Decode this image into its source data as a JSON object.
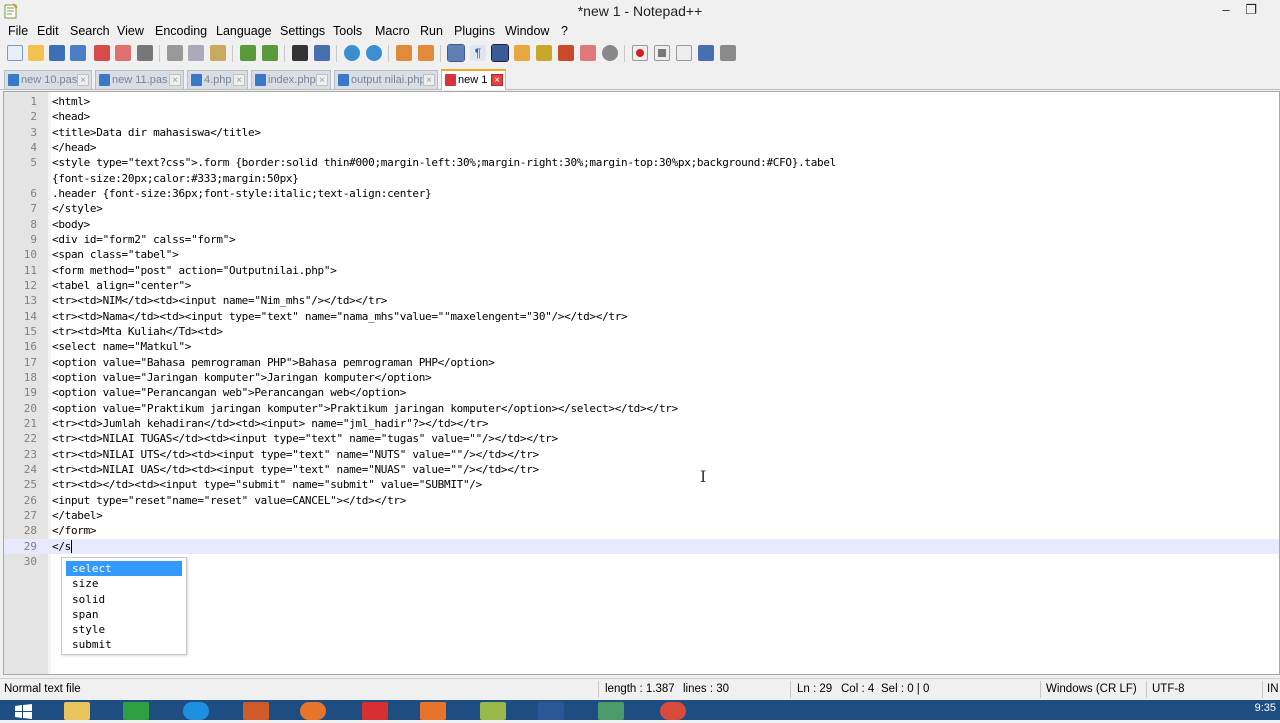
{
  "window": {
    "title": "*new 1 - Notepad++"
  },
  "menu": [
    "File",
    "Edit",
    "Search",
    "View",
    "Encoding",
    "Language",
    "Settings",
    "Tools",
    "Macro",
    "Run",
    "Plugins",
    "Window",
    "?"
  ],
  "tabs": [
    {
      "label": "new 10.pas",
      "active": false
    },
    {
      "label": "new 11.pas",
      "active": false
    },
    {
      "label": "4.php",
      "active": false
    },
    {
      "label": "index.php",
      "active": false
    },
    {
      "label": "output nilai.php",
      "active": false
    },
    {
      "label": "new 1",
      "active": true
    }
  ],
  "editor": {
    "current_line": 29,
    "lines": [
      {
        "n": "1",
        "text": "<html>"
      },
      {
        "n": "2",
        "text": "<head>"
      },
      {
        "n": "3",
        "text": "<title>Data dir mahasiswa</title>"
      },
      {
        "n": "4",
        "text": "</head>"
      },
      {
        "n": "5",
        "text": "<style type=\"text?css\">.form {border:solid thin#000;margin-left:30%;margin-right:30%;margin-top:30%px;background:#CFO}.tabel"
      },
      {
        "n": "",
        "text": "{font-size:20px;calor:#333;margin:50px}"
      },
      {
        "n": "6",
        "text": ".header {font-size:36px;font-style:italic;text-align:center}"
      },
      {
        "n": "7",
        "text": "</style>"
      },
      {
        "n": "8",
        "text": "<body>"
      },
      {
        "n": "9",
        "text": "<div id=\"form2\" calss=\"form\">"
      },
      {
        "n": "10",
        "text": "<span class=\"tabel\">"
      },
      {
        "n": "11",
        "text": "<form method=\"post\" action=\"Outputnilai.php\">"
      },
      {
        "n": "12",
        "text": "<tabel align=\"center\">"
      },
      {
        "n": "13",
        "text": "<tr><td>NIM</td><td><input name=\"Nim_mhs\"/></td></tr>"
      },
      {
        "n": "14",
        "text": "<tr><td>Nama</td><td><input type=\"text\" name=\"nama_mhs\"value=\"\"maxelengent=\"30\"/></td></tr>"
      },
      {
        "n": "15",
        "text": "<tr><td>Mta Kuliah</Td><td>"
      },
      {
        "n": "16",
        "text": "<select name=\"Matkul\">"
      },
      {
        "n": "17",
        "text": "<option value=\"Bahasa pemrograman PHP\">Bahasa pemrograman PHP</option>"
      },
      {
        "n": "18",
        "text": "<option value=\"Jaringan komputer\">Jaringan komputer</option>"
      },
      {
        "n": "19",
        "text": "<option value=\"Perancangan web\">Perancangan web</option>"
      },
      {
        "n": "20",
        "text": "<option value=\"Praktikum jaringan komputer\">Praktikum jaringan komputer</option></select></td></tr>"
      },
      {
        "n": "21",
        "text": "<tr><td>Jumlah kehadiran</td><td><input> name=\"jml_hadir\"?></td></tr>"
      },
      {
        "n": "22",
        "text": "<tr><td>NILAI TUGAS</td><td><input type=\"text\" name=\"tugas\" value=\"\"/></td></tr>"
      },
      {
        "n": "23",
        "text": "<tr><td>NILAI UTS</td><td><input type=\"text\" name=\"NUTS\" value=\"\"/></td></tr>"
      },
      {
        "n": "24",
        "text": "<tr><td>NILAI UAS</td><td><input type=\"text\" name=\"NUAS\" value=\"\"/></td></tr>"
      },
      {
        "n": "25",
        "text": "<tr><td></td><td><input type=\"submit\" name=\"submit\" value=\"SUBMIT\"/>"
      },
      {
        "n": "26",
        "text": "<input type=\"reset\"name=\"reset\" value=CANCEL\"></td></tr>"
      },
      {
        "n": "27",
        "text": "</tabel>"
      },
      {
        "n": "28",
        "text": "</form>"
      },
      {
        "n": "29",
        "text": "</s"
      },
      {
        "n": "30",
        "text": ""
      }
    ]
  },
  "autocomplete": {
    "items": [
      "select",
      "size",
      "solid",
      "span",
      "style",
      "submit"
    ],
    "selected": "select"
  },
  "status": {
    "file_type": "Normal text file",
    "length": "length : 1.387",
    "lines": "lines : 30",
    "ln": "Ln : 29",
    "col": "Col : 4",
    "sel": "Sel : 0 | 0",
    "eol": "Windows (CR LF)",
    "encoding": "UTF-8",
    "mode": "IN"
  },
  "clock": "9:35",
  "colors": {
    "accent_tab": "#f5a623",
    "current_line": "#e8e8ff",
    "autocomplete_selected": "#3399ff",
    "taskbar": "#1e4d82"
  },
  "icons": {
    "toolbar": [
      "new-file-icon",
      "open-file-icon",
      "save-icon",
      "save-all-icon",
      "close-icon",
      "close-all-icon",
      "print-icon",
      "cut-icon",
      "copy-icon",
      "paste-icon",
      "undo-icon",
      "redo-icon",
      "find-icon",
      "replace-icon",
      "zoom-in-icon",
      "zoom-out-icon",
      "sync-v-icon",
      "sync-h-icon",
      "word-wrap-icon",
      "show-all-chars-icon",
      "indent-guide-icon",
      "lang-icon",
      "folder-workspace-icon",
      "function-list-icon",
      "doc-map-icon",
      "record-macro-icon",
      "stop-macro-icon",
      "play-macro-icon",
      "run-macro-multiple-icon",
      "save-macro-icon"
    ],
    "taskbar": [
      "start-icon",
      "explorer-icon",
      "store-icon",
      "ie-icon",
      "app-icon",
      "firefox-icon",
      "game-icon",
      "xampp-icon",
      "notepadpp-icon",
      "word-icon",
      "app2-icon",
      "chrome-icon"
    ]
  }
}
